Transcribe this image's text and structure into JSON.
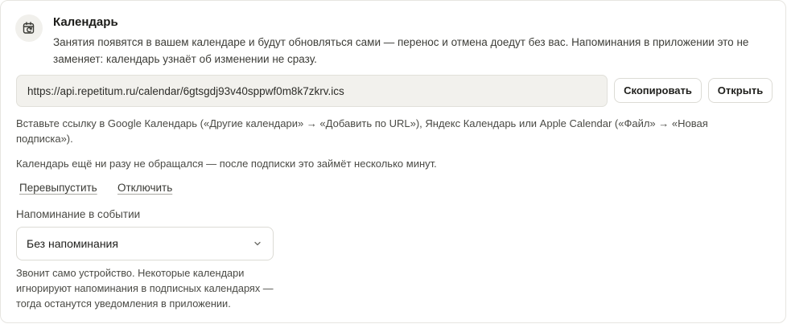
{
  "calendar": {
    "title": "Календарь",
    "description": "Занятия появятся в вашем календаре и будут обновляться сами — перенос и отмена доедут без вас. Напоминания в приложении это не заменяет: календарь узнаёт об изменении не сразу.",
    "icon": "calendar-sync-icon",
    "url": "https://api.repetitum.ru/calendar/6gtsgdj93v40sppwf0m8k7zkrv.ics",
    "copy_label": "Скопировать",
    "open_label": "Открыть",
    "hint": "Вставьте ссылку в Google Календарь («Другие календари» → «Добавить по URL»), Яндекс Календарь или Apple Calendar («Файл» → «Новая подписка»).",
    "status": "Календарь ещё ни разу не обращался — после подписки это займёт несколько минут.",
    "reissue_label": "Перевыпустить",
    "disable_label": "Отключить",
    "reminder": {
      "label": "Напоминание в событии",
      "selected": "Без напоминания",
      "note": "Звонит само устройство. Некоторые календари игнорируют напоминания в подписных календарях — тогда останутся уведомления в приложении."
    }
  }
}
